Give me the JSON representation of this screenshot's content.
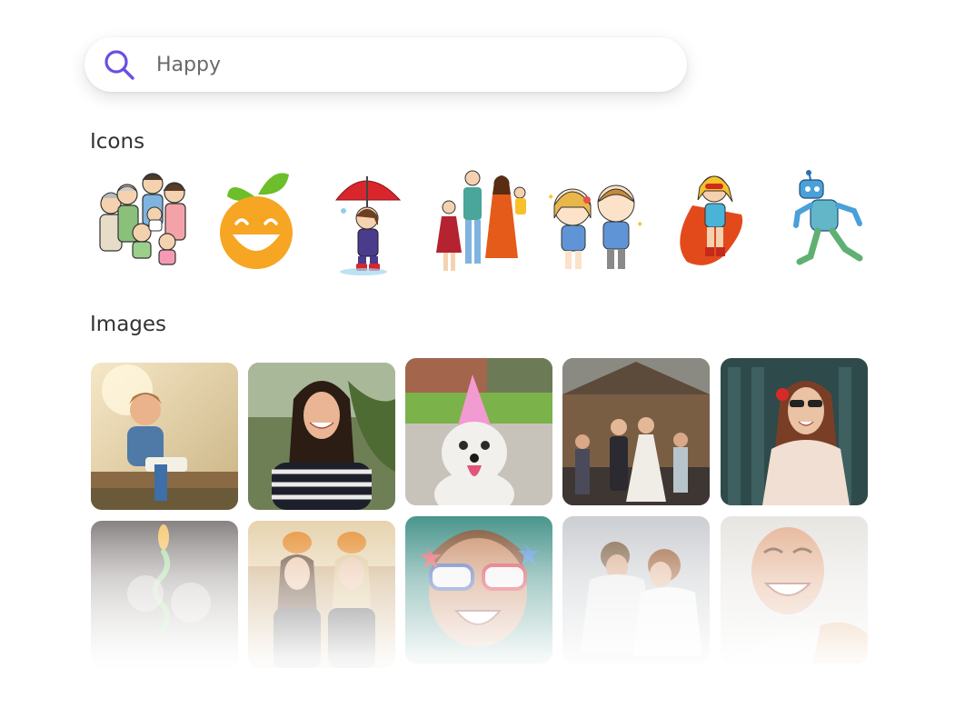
{
  "search": {
    "value": "Happy"
  },
  "sections": {
    "icons_title": "Icons",
    "images_title": "Images"
  },
  "icons": [
    {
      "name": "family-group-icon"
    },
    {
      "name": "happy-orange-icon"
    },
    {
      "name": "girl-umbrella-icon"
    },
    {
      "name": "family-parents-icon"
    },
    {
      "name": "two-kids-icon"
    },
    {
      "name": "superhero-girl-icon"
    },
    {
      "name": "robot-icon"
    }
  ],
  "images": [
    {
      "name": "laughing-boy-image"
    },
    {
      "name": "smiling-woman-image"
    },
    {
      "name": "party-dog-image"
    },
    {
      "name": "wedding-couple-image"
    },
    {
      "name": "woman-sunglasses-image"
    },
    {
      "name": "birthday-candle-image"
    },
    {
      "name": "pumpkin-friends-image"
    },
    {
      "name": "kid-glasses-image"
    },
    {
      "name": "couple-embrace-image"
    },
    {
      "name": "smiling-man-image"
    }
  ],
  "colors": {
    "accent": "#6b4fe0",
    "text": "#333333",
    "placeholder": "#6a6a6a"
  }
}
